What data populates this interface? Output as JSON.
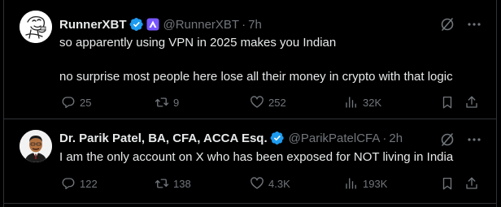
{
  "colors": {
    "background": "#000000",
    "text_primary": "#e7e9ea",
    "text_secondary": "#71767b",
    "verified_blue": "#1d9bf0",
    "badge_purple": "#7856ff",
    "divider": "#2f3336"
  },
  "posts": [
    {
      "author_name": "RunnerXBT",
      "verified_icon": "verified-badge-icon",
      "affiliate_icon": "purple-affiliate-badge-icon",
      "handle": "@RunnerXBT",
      "separator": "·",
      "time": "7h",
      "text_lines": [
        "so apparently using VPN in 2025 makes you Indian",
        "no surprise most people here lose all their money in crypto with that logic"
      ],
      "stats": {
        "replies": "25",
        "reposts": "9",
        "likes": "252",
        "views": "32K"
      }
    },
    {
      "author_name": "Dr. Parik Patel, BA, CFA, ACCA Esq.",
      "verified_icon": "verified-badge-icon",
      "handle": "@ParikPatelCFA",
      "separator": "·",
      "time": "2h",
      "text_lines": [
        "I am the only account on X who has been exposed for NOT living in India"
      ],
      "stats": {
        "replies": "122",
        "reposts": "138",
        "likes": "4.3K",
        "views": "193K"
      }
    }
  ]
}
